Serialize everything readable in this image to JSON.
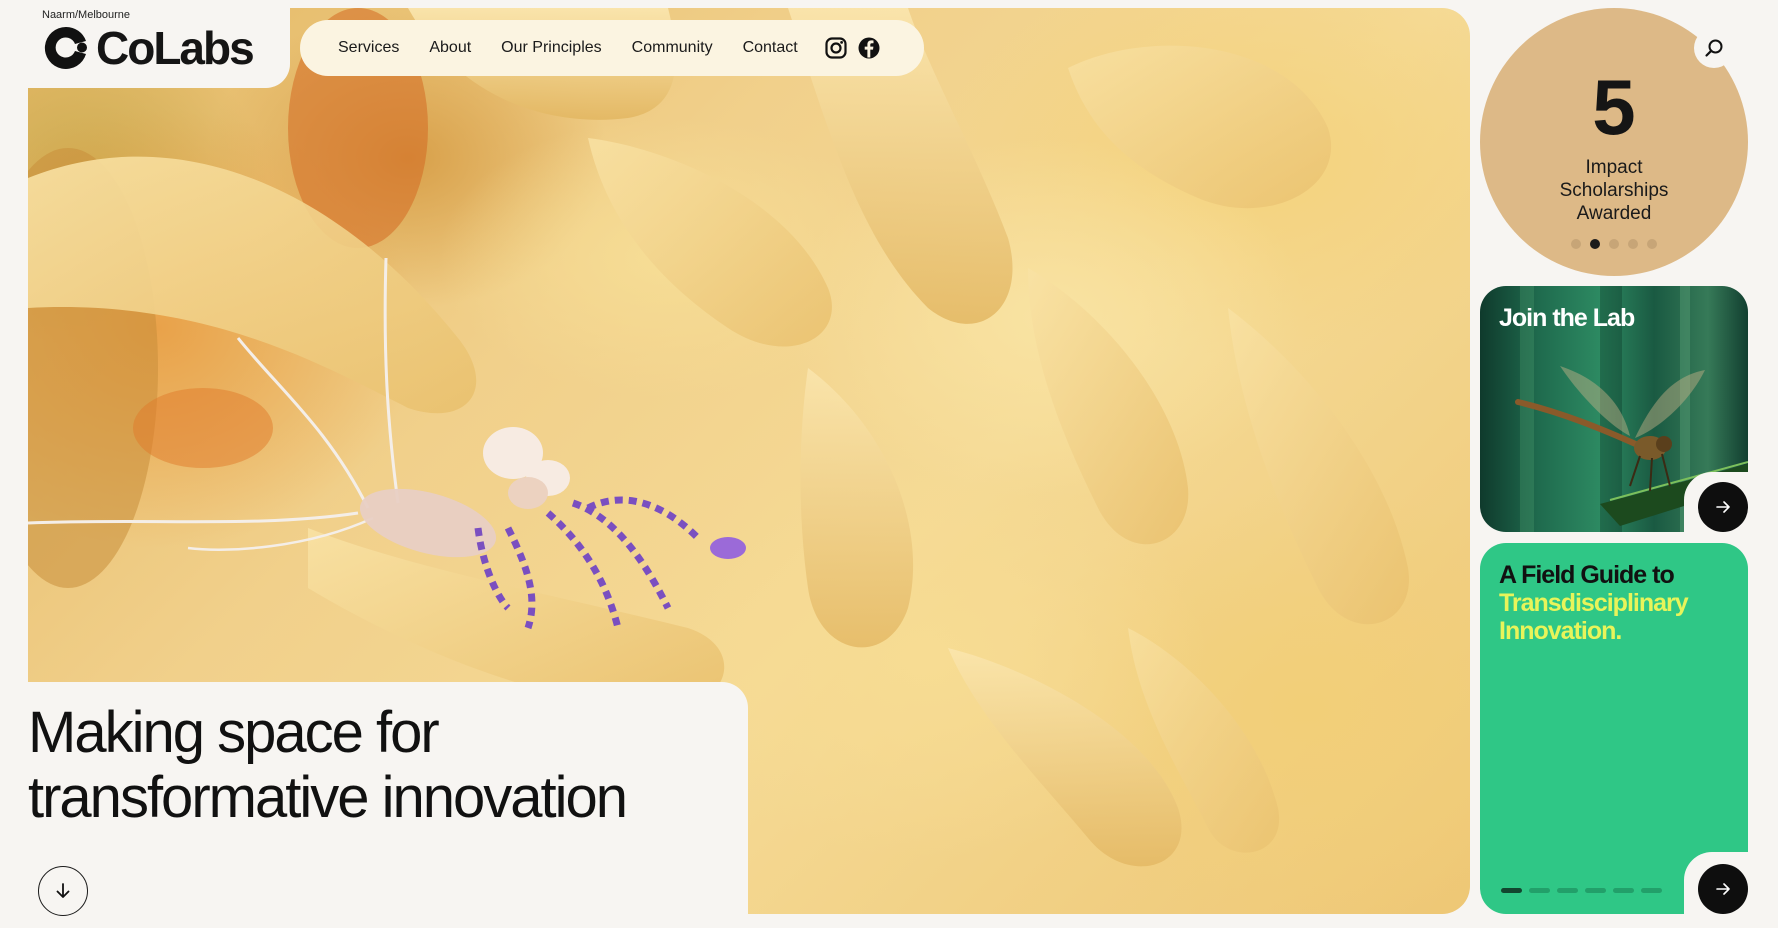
{
  "brand": {
    "region": "Naarm/Melbourne",
    "name": "CoLabs",
    "logo_icon": "colabs-c-mark-icon"
  },
  "nav": {
    "items": [
      {
        "label": "Services"
      },
      {
        "label": "About"
      },
      {
        "label": "Our Principles"
      },
      {
        "label": "Community"
      },
      {
        "label": "Contact"
      }
    ],
    "social": [
      "instagram-icon",
      "facebook-icon"
    ]
  },
  "hero": {
    "image": "anemone-cleaner-shrimp-photo",
    "tagline_line1": "Making space for",
    "tagline_line2": "transformative innovation",
    "scroll_icon": "arrow-down-icon"
  },
  "search": {
    "icon": "search-icon"
  },
  "stat": {
    "number": "5",
    "label": "Impact Scholarships Awarded",
    "dots": 5,
    "active_dot": 1,
    "color": "#ddb987"
  },
  "cards": {
    "join": {
      "title": "Join the Lab",
      "image": "dragonfly-photo",
      "arrow_icon": "arrow-right-icon"
    },
    "guide": {
      "title_part1": "A Field Guide to",
      "title_part2": "Transdisciplinary Innovation.",
      "color": "#2fc786",
      "highlight_color": "#e8f45a",
      "dots": 6,
      "active_dot": 0,
      "arrow_icon": "arrow-right-icon"
    }
  }
}
